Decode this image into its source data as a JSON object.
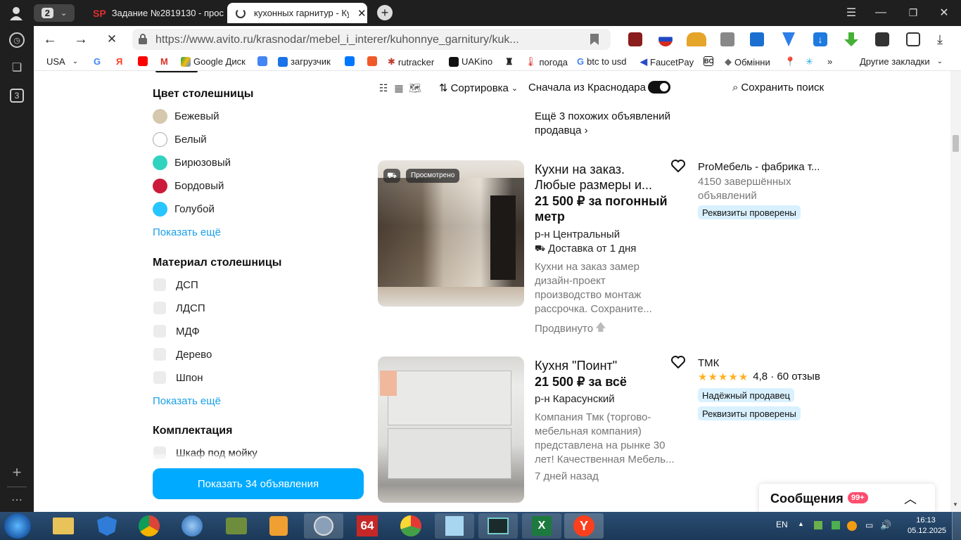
{
  "browser": {
    "tab_count": "2",
    "tabs": [
      {
        "label": "Задание №2819130 - прос"
      },
      {
        "label": "кухонных гарнитур - Ку"
      }
    ],
    "url": "https://www.avito.ru/krasnodar/mebel_i_interer/kuhonnye_garnitury/kuk...",
    "sidebar_badge": "3",
    "bookmarks": [
      "USA",
      "Google Диск",
      "загрузчик",
      "rutracker",
      "UAKino",
      "погода",
      "btc to usd",
      "FaucetPay",
      "Обмінни",
      "Другие закладки"
    ]
  },
  "toolbar": {
    "sort_label": "Сортировка",
    "toggle_label": "Сначала из Краснодара",
    "save_search_label": "Сохранить поиск"
  },
  "filters": {
    "countertop_color_title": "Цвет столешницы",
    "colors": [
      {
        "label": "Бежевый",
        "color": "#d5c8ad"
      },
      {
        "label": "Белый",
        "color": "#ffffff"
      },
      {
        "label": "Бирюзовый",
        "color": "#32d2c0"
      },
      {
        "label": "Бордовый",
        "color": "#cc1b3a"
      },
      {
        "label": "Голубой",
        "color": "#27c5ff"
      }
    ],
    "show_more_1": "Показать ещё",
    "material_title": "Материал столешницы",
    "materials": [
      "ДСП",
      "ЛДСП",
      "МДФ",
      "Дерево",
      "Шпон"
    ],
    "show_more_2": "Показать ещё",
    "equipment_title": "Комплектация",
    "equipment_first": "Шкаф под мойку",
    "show_button": "Показать 34 объявления"
  },
  "listings": {
    "more_from_seller": "Ещё 3 похожих объявлений продавца",
    "items": [
      {
        "viewed_badge": "Просмотрено",
        "title_line1": "Кухни на заказ.",
        "title_line2": "Любые размеры и...",
        "price_line1": "21 500 ₽ за погонный",
        "price_line2": "метр",
        "district": "р-н Центральный",
        "delivery": "Доставка от 1 дня",
        "desc": [
          "Кухни на заказ замер",
          "дизайн-проект",
          "производство монтаж",
          "рассрочка. Сохраните..."
        ],
        "promoted": "Продвинуто",
        "seller": "ProМебель - фабрика т...",
        "seller_stats_1": "4150 завершённых",
        "seller_stats_2": "объявлений",
        "badge_verified": "Реквизиты проверены"
      },
      {
        "title": "Кухня \"Поинт\"",
        "price": "21 500 ₽ за всё",
        "district": "р-н Карасунский",
        "desc": [
          "Компания Тмк (торгово-",
          "мебельная компания)",
          "представлена на рынке 30",
          "лет! Качественная Мебель..."
        ],
        "date": "7 дней назад",
        "seller": "ТМК",
        "rating_stars": "★★★★★",
        "rating": "4,8 · 60 отзыв",
        "badge_reliable": "Надёжный продавец",
        "badge_verified": "Реквизиты проверены"
      }
    ]
  },
  "messages": {
    "label": "Сообщения",
    "count": "99+"
  },
  "taskbar": {
    "lang": "EN",
    "time": "16:13",
    "date": "05.12.2025"
  }
}
